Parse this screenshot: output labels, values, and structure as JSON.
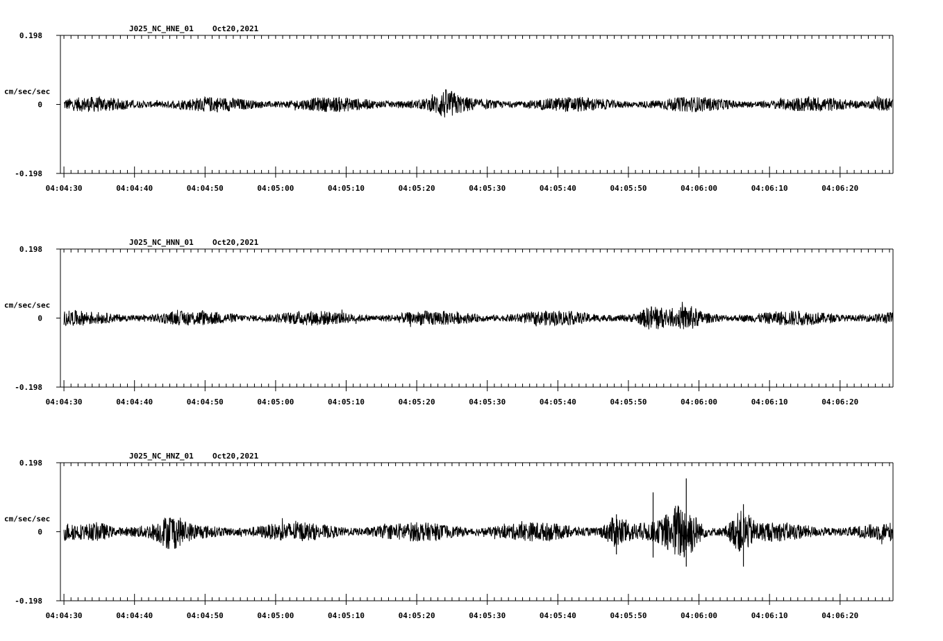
{
  "chart_data": [
    {
      "type": "line",
      "title": "J025_NC_HNE_01",
      "date": "Oct20,2021",
      "ylabel": "cm/sec/sec",
      "ylim": [
        -0.198,
        0.198
      ],
      "ytick_labels": [
        "0.198",
        "0",
        "-0.198"
      ],
      "xlim_seconds": [
        -0.5,
        117.5
      ],
      "xtick_labels": [
        "04:04:30",
        "04:04:40",
        "04:04:50",
        "04:05:00",
        "04:05:10",
        "04:05:20",
        "04:05:30",
        "04:05:40",
        "04:05:50",
        "04:06:00",
        "04:06:10",
        "04:06:20"
      ],
      "trace": {
        "start_seconds": 0,
        "end_seconds": 117.5,
        "noise_amplitude": 0.022,
        "bursts": [
          [
            54.2,
            0.06
          ],
          [
            116.0,
            0.04
          ]
        ],
        "spikes": []
      },
      "grid": false
    },
    {
      "type": "line",
      "title": "J025_NC_HNN_01",
      "date": "Oct20,2021",
      "ylabel": "cm/sec/sec",
      "ylim": [
        -0.198,
        0.198
      ],
      "ytick_labels": [
        "0.198",
        "0",
        "-0.198"
      ],
      "xlim_seconds": [
        -0.5,
        117.5
      ],
      "xtick_labels": [
        "04:04:30",
        "04:04:40",
        "04:04:50",
        "04:05:00",
        "04:05:10",
        "04:05:20",
        "04:05:30",
        "04:05:40",
        "04:05:50",
        "04:06:00",
        "04:06:10",
        "04:06:20"
      ],
      "trace": {
        "start_seconds": 0,
        "end_seconds": 117.5,
        "noise_amplitude": 0.022,
        "bursts": [
          [
            83.5,
            0.055
          ],
          [
            88.5,
            0.05
          ]
        ],
        "spikes": []
      },
      "grid": false
    },
    {
      "type": "line",
      "title": "J025_NC_HNZ_01",
      "date": "Oct20,2021",
      "ylabel": "cm/sec/sec",
      "ylim": [
        -0.198,
        0.198
      ],
      "ytick_labels": [
        "0.198",
        "0",
        "-0.198"
      ],
      "xlim_seconds": [
        -0.5,
        117.5
      ],
      "xtick_labels": [
        "04:04:30",
        "04:04:40",
        "04:04:50",
        "04:05:00",
        "04:05:10",
        "04:05:20",
        "04:05:30",
        "04:05:40",
        "04:05:50",
        "04:06:00",
        "04:06:10",
        "04:06:20"
      ],
      "trace": {
        "start_seconds": 0,
        "end_seconds": 117.5,
        "noise_amplitude": 0.028,
        "bursts": [
          [
            5,
            0.05
          ],
          [
            15.2,
            0.07
          ],
          [
            78.3,
            0.08
          ],
          [
            86.5,
            0.1
          ],
          [
            88.5,
            0.11
          ],
          [
            96.0,
            0.1
          ]
        ],
        "spikes": [
          [
            83.5,
            0.113,
            -0.074
          ],
          [
            88.2,
            0.153,
            -0.1
          ],
          [
            96.3,
            0.079,
            -0.1
          ],
          [
            78.3,
            0.05,
            -0.065
          ]
        ]
      },
      "grid": false
    }
  ]
}
